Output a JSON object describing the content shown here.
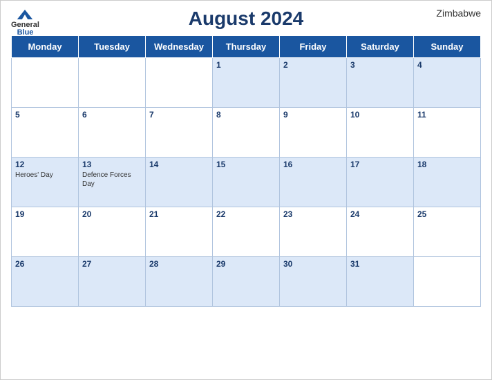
{
  "header": {
    "title": "August 2024",
    "country": "Zimbabwe",
    "logo_general": "General",
    "logo_blue": "Blue"
  },
  "days": [
    "Monday",
    "Tuesday",
    "Wednesday",
    "Thursday",
    "Friday",
    "Saturday",
    "Sunday"
  ],
  "weeks": [
    [
      {
        "num": "",
        "empty": true
      },
      {
        "num": "",
        "empty": true
      },
      {
        "num": "",
        "empty": true
      },
      {
        "num": "1",
        "event": ""
      },
      {
        "num": "2",
        "event": ""
      },
      {
        "num": "3",
        "event": ""
      },
      {
        "num": "4",
        "event": ""
      }
    ],
    [
      {
        "num": "5",
        "event": ""
      },
      {
        "num": "6",
        "event": ""
      },
      {
        "num": "7",
        "event": ""
      },
      {
        "num": "8",
        "event": ""
      },
      {
        "num": "9",
        "event": ""
      },
      {
        "num": "10",
        "event": ""
      },
      {
        "num": "11",
        "event": ""
      }
    ],
    [
      {
        "num": "12",
        "event": "Heroes' Day"
      },
      {
        "num": "13",
        "event": "Defence Forces Day"
      },
      {
        "num": "14",
        "event": ""
      },
      {
        "num": "15",
        "event": ""
      },
      {
        "num": "16",
        "event": ""
      },
      {
        "num": "17",
        "event": ""
      },
      {
        "num": "18",
        "event": ""
      }
    ],
    [
      {
        "num": "19",
        "event": ""
      },
      {
        "num": "20",
        "event": ""
      },
      {
        "num": "21",
        "event": ""
      },
      {
        "num": "22",
        "event": ""
      },
      {
        "num": "23",
        "event": ""
      },
      {
        "num": "24",
        "event": ""
      },
      {
        "num": "25",
        "event": ""
      }
    ],
    [
      {
        "num": "26",
        "event": ""
      },
      {
        "num": "27",
        "event": ""
      },
      {
        "num": "28",
        "event": ""
      },
      {
        "num": "29",
        "event": ""
      },
      {
        "num": "30",
        "event": ""
      },
      {
        "num": "31",
        "event": ""
      },
      {
        "num": "",
        "empty": true
      }
    ]
  ]
}
